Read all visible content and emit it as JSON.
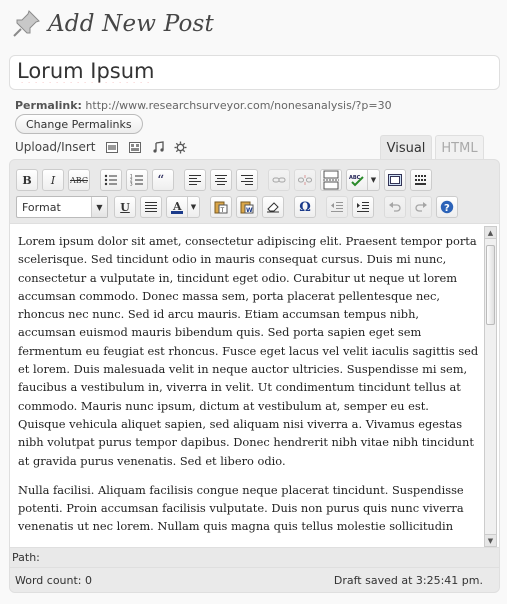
{
  "header": {
    "title": "Add New Post",
    "icon": "pushpin-icon"
  },
  "post": {
    "title_value": "Lorum Ipsum"
  },
  "permalink": {
    "label": "Permalink:",
    "url": "http://www.researchsurveyor.com/nonesanalysis/?p=30",
    "change_button": "Change Permalinks"
  },
  "media": {
    "label": "Upload/Insert",
    "icons": [
      "image-icon",
      "video-icon",
      "audio-icon",
      "media-icon"
    ]
  },
  "tabs": {
    "visual": "Visual",
    "html": "HTML"
  },
  "toolbar": {
    "bold": "B",
    "italic": "I",
    "strike": "ABC",
    "format_select": "Format",
    "underline": "U",
    "omega": "Ω"
  },
  "content": {
    "paragraphs": [
      "Lorem ipsum dolor sit amet, consectetur adipiscing elit. Praesent tempor porta scelerisque. Sed tincidunt odio in mauris consequat cursus. Duis mi nunc, consectetur a vulputate in, tincidunt eget odio. Curabitur ut neque ut lorem accumsan commodo. Donec massa sem, porta placerat pellentesque nec, rhoncus nec nunc. Sed id arcu mauris. Etiam accumsan tempus nibh, accumsan euismod mauris bibendum quis. Sed porta sapien eget sem fermentum eu feugiat est rhoncus. Fusce eget lacus vel velit iaculis sagittis sed et lorem. Duis malesuada velit in neque auctor ultricies. Suspendisse mi sem, faucibus a vestibulum in, viverra in velit. Ut condimentum tincidunt tellus at commodo. Mauris nunc ipsum, dictum at vestibulum at, semper eu est. Quisque vehicula aliquet sapien, sed aliquam nisi viverra a. Vivamus egestas nibh volutpat purus tempor dapibus. Donec hendrerit nibh vitae nibh tincidunt at gravida purus venenatis. Sed et libero odio.",
      "Nulla facilisi. Aliquam facilisis congue neque placerat tincidunt. Suspendisse potenti. Proin accumsan facilisis vulputate. Duis non purus quis nunc viverra venenatis ut nec lorem. Nullam quis magna quis tellus molestie sollicitudin"
    ]
  },
  "footer": {
    "path_label": "Path:",
    "word_count": "Word count: 0",
    "draft_saved": "Draft saved at 3:25:41 pm."
  },
  "colors": {
    "background": "#f9f9f9",
    "editor_bg": "#e9e9e9",
    "border": "#dfdfdf"
  }
}
